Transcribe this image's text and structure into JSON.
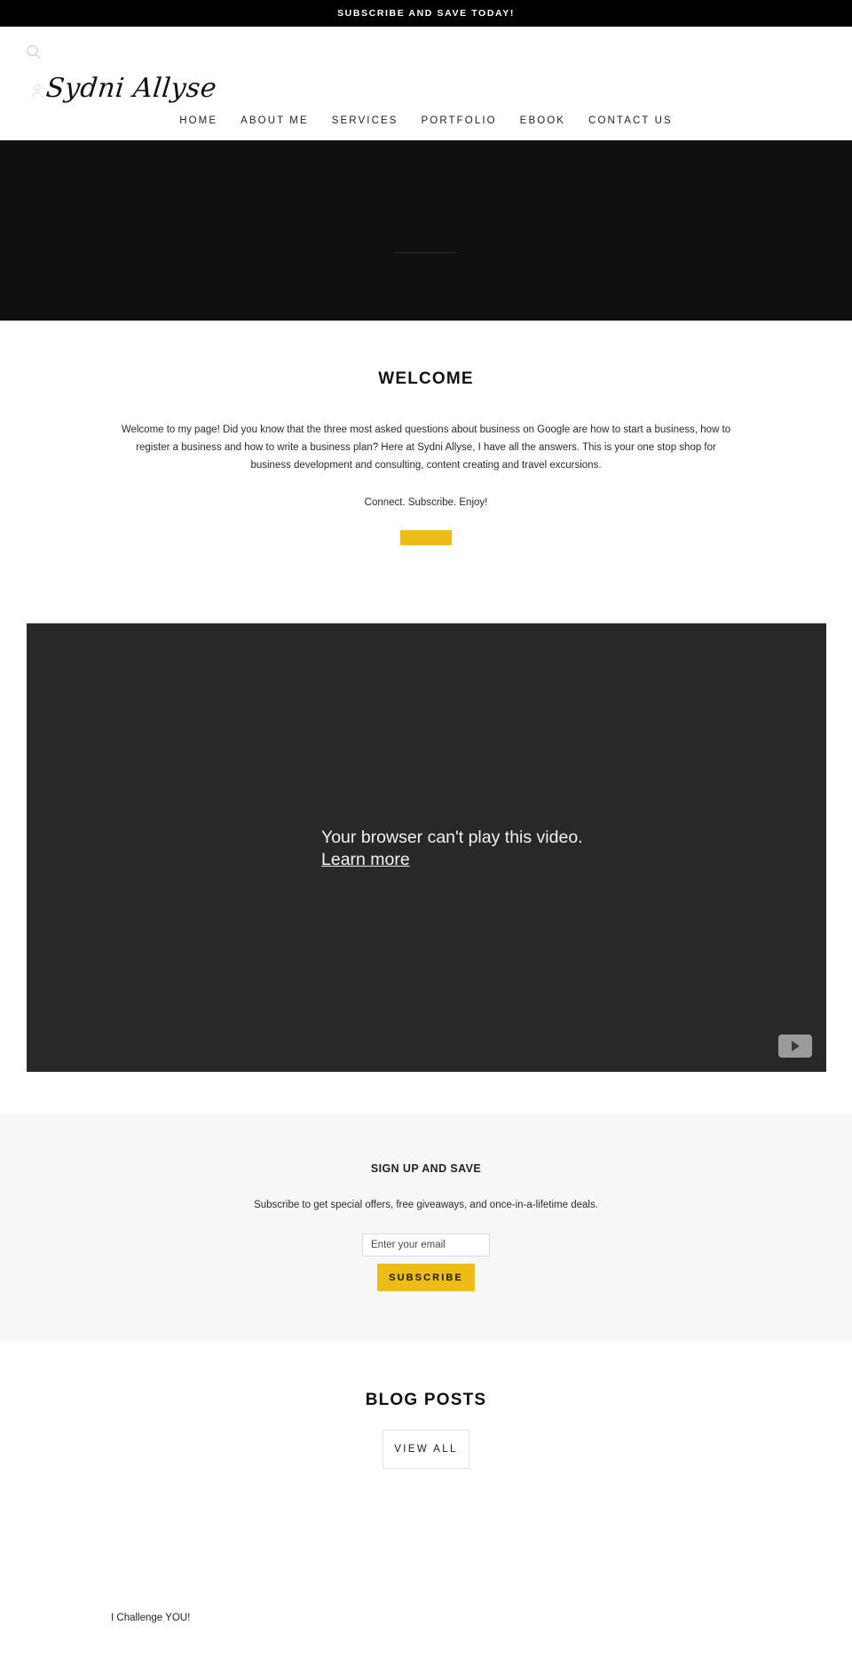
{
  "announcement": {
    "text": "SUBSCRIBE AND SAVE TODAY!"
  },
  "header": {
    "search_icon": "search-icon",
    "brand_icon": "person-icon",
    "brand_name": "Sydni Allyse",
    "nav": [
      {
        "label": "HOME"
      },
      {
        "label": "ABOUT ME"
      },
      {
        "label": "SERVICES"
      },
      {
        "label": "PORTFOLIO"
      },
      {
        "label": "EBOOK"
      },
      {
        "label": "CONTACT US"
      }
    ]
  },
  "hero": {
    "background_color": "#101010",
    "title": ""
  },
  "welcome": {
    "title": "WELCOME",
    "body": "Welcome to my page! Did you know that the three most asked questions about business on Google are how to start a business, how to register a business and how to write a business plan? Here at Sydni Allyse, I have all the answers. This is your one stop shop for business development and consulting, content creating and travel excursions.",
    "tagline": "Connect. Subscribe. Enjoy!",
    "cta_label": "",
    "cta_color": "#eebc16"
  },
  "video": {
    "message_line1": "Your browser can't play this video.",
    "message_line2": "Learn more",
    "play_icon": "play-icon",
    "background_color": "#282828"
  },
  "newsletter": {
    "title": "SIGN UP AND SAVE",
    "subtitle": "Subscribe to get special offers, free giveaways, and once-in-a-lifetime deals.",
    "email_placeholder": "Enter your email",
    "email_value": "",
    "subscribe_label": "SUBSCRIBE",
    "subscribe_color": "#eebc16",
    "background_color": "#f7f7f7"
  },
  "blog": {
    "title": "BLOG POSTS",
    "view_all_label": "VIEW ALL",
    "posts": [
      {
        "title": "I Challenge YOU!"
      }
    ]
  }
}
